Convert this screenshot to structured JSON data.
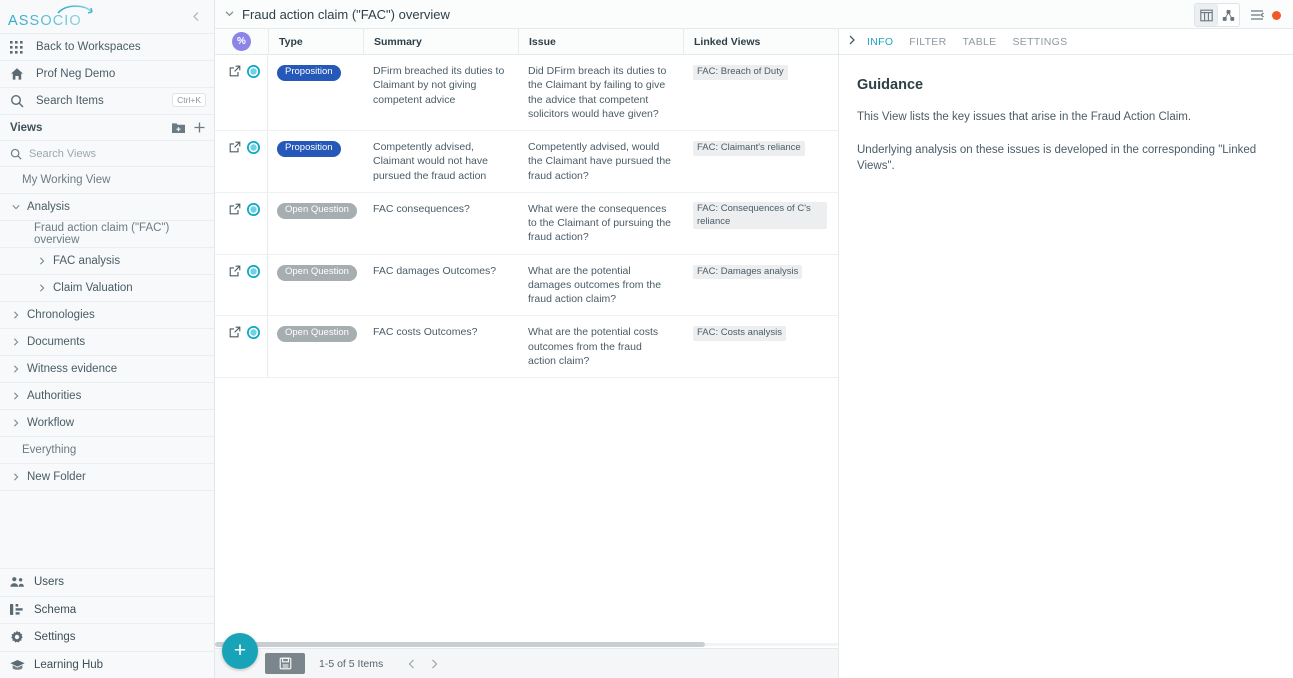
{
  "sidebar": {
    "logo_text": "ASSOCIO",
    "collapse_icon": "chevron-left-icon",
    "nav": [
      {
        "icon": "grid-icon",
        "label": "Back to Workspaces",
        "shortcut": ""
      },
      {
        "icon": "home-icon",
        "label": "Prof Neg Demo",
        "shortcut": ""
      },
      {
        "icon": "search-icon",
        "label": "Search Items",
        "shortcut": "Ctrl+K"
      }
    ],
    "views_header": {
      "label": "Views",
      "new_folder_icon": "folder-plus-icon",
      "add_icon": "plus-icon"
    },
    "views_search_placeholder": "Search Views",
    "tree": [
      {
        "label": "My Working View",
        "level": 0,
        "caret": "none",
        "muted": true
      },
      {
        "label": "Analysis",
        "level": 0,
        "caret": "down",
        "muted": false
      },
      {
        "label": "Fraud action claim (\"FAC\") overview",
        "level": 1,
        "caret": "none",
        "muted": true
      },
      {
        "label": "FAC analysis",
        "level": 2,
        "caret": "right",
        "muted": false
      },
      {
        "label": "Claim Valuation",
        "level": 2,
        "caret": "right",
        "muted": false
      },
      {
        "label": "Chronologies",
        "level": 0,
        "caret": "right",
        "muted": false
      },
      {
        "label": "Documents",
        "level": 0,
        "caret": "right",
        "muted": false
      },
      {
        "label": "Witness evidence",
        "level": 0,
        "caret": "right",
        "muted": false
      },
      {
        "label": "Authorities",
        "level": 0,
        "caret": "right",
        "muted": false
      },
      {
        "label": "Workflow",
        "level": 0,
        "caret": "right",
        "muted": false
      },
      {
        "label": "Everything",
        "level": 0,
        "caret": "none",
        "muted": true
      },
      {
        "label": "New Folder",
        "level": 0,
        "caret": "right",
        "muted": false
      }
    ],
    "bottom": [
      {
        "icon": "users-icon",
        "label": "Users"
      },
      {
        "icon": "schema-icon",
        "label": "Schema"
      },
      {
        "icon": "gear-icon",
        "label": "Settings"
      },
      {
        "icon": "graduation-cap-icon",
        "label": "Learning Hub"
      }
    ]
  },
  "titlebar": {
    "caret_icon": "chevron-down-icon",
    "title": "Fraud action claim (\"FAC\") overview",
    "icons": [
      {
        "name": "table-view-icon",
        "active": true
      },
      {
        "name": "graph-view-icon",
        "active": false
      },
      {
        "name": "collapse-list-icon",
        "active": false
      },
      {
        "name": "record-dot-icon",
        "active": false
      }
    ],
    "record_color": "#f05a28"
  },
  "table": {
    "badge_symbol": "%",
    "badge_color": "#8b85e8",
    "columns": [
      "Type",
      "Summary",
      "Issue",
      "Linked Views"
    ],
    "rows": [
      {
        "type": "Proposition",
        "type_style": "proposition",
        "summary": "DFirm breached its duties to Claimant by not giving competent advice",
        "issue": "Did DFirm breach its duties to the Claimant by failing to give the advice that competent solicitors would have given?",
        "linked": "FAC: Breach of Duty"
      },
      {
        "type": "Proposition",
        "type_style": "proposition",
        "summary": "Competently advised, Claimant would not have pursued the fraud action",
        "issue": "Competently advised, would the Claimant have pursued the fraud action?",
        "linked": "FAC: Claimant's reliance"
      },
      {
        "type": "Open Question",
        "type_style": "open-question",
        "summary": "FAC consequences?",
        "issue": "What were the consequences to the Claimant of pursuing the fraud action?",
        "linked": "FAC: Consequences of C's reliance"
      },
      {
        "type": "Open Question",
        "type_style": "open-question",
        "summary": "FAC damages Outcomes?",
        "issue": "What are the potential damages outcomes from the fraud action claim?",
        "linked": "FAC: Damages analysis"
      },
      {
        "type": "Open Question",
        "type_style": "open-question",
        "summary": "FAC costs Outcomes?",
        "issue": "What are the potential costs outcomes from the fraud action claim?",
        "linked": "FAC: Costs analysis"
      }
    ]
  },
  "footer": {
    "add_label": "+",
    "save_icon": "save-icon",
    "pagination": "1-5 of 5 Items",
    "prev_icon": "chevron-left-icon",
    "next_icon": "chevron-right-icon"
  },
  "right_panel": {
    "expand_icon": "chevron-right-icon",
    "tabs": [
      {
        "label": "INFO",
        "active": true
      },
      {
        "label": "FILTER",
        "active": false
      },
      {
        "label": "TABLE",
        "active": false
      },
      {
        "label": "SETTINGS",
        "active": false
      }
    ],
    "heading": "Guidance",
    "paragraphs": [
      "This View lists the key issues that arise in the Fraud Action Claim.",
      "Underlying analysis on these issues is developed in the corresponding \"Linked Views\"."
    ],
    "accent_color": "#1fa5c4"
  }
}
